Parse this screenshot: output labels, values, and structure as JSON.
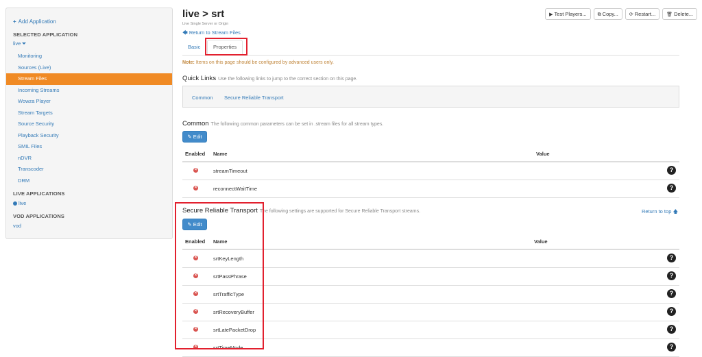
{
  "sidebar": {
    "add_application": "Add Application",
    "selected_heading": "SELECTED APPLICATION",
    "selected_app": "live",
    "menu": [
      {
        "label": "Monitoring",
        "active": false
      },
      {
        "label": "Sources (Live)",
        "active": false
      },
      {
        "label": "Stream Files",
        "active": true
      },
      {
        "label": "Incoming Streams",
        "active": false
      },
      {
        "label": "Wowza Player",
        "active": false
      },
      {
        "label": "Stream Targets",
        "active": false
      },
      {
        "label": "Source Security",
        "active": false
      },
      {
        "label": "Playback Security",
        "active": false
      },
      {
        "label": "SMIL Files",
        "active": false
      },
      {
        "label": "nDVR",
        "active": false
      },
      {
        "label": "Transcoder",
        "active": false
      },
      {
        "label": "DRM",
        "active": false
      }
    ],
    "live_heading": "LIVE APPLICATIONS",
    "live_app": "live",
    "vod_heading": "VOD APPLICATIONS",
    "vod_app": "vod"
  },
  "header": {
    "title": "live > srt",
    "subtitle": "Live Single Server or Origin",
    "return_link": "Return to Stream Files",
    "buttons": {
      "test_players": "Test Players...",
      "copy": "Copy...",
      "restart": "Restart...",
      "delete": "Delete..."
    }
  },
  "tabs": {
    "basic": "Basic",
    "properties": "Properties"
  },
  "note": {
    "label": "Note:",
    "text": "Items on this page should be configured by advanced users only."
  },
  "quick_links": {
    "title": "Quick Links",
    "desc": "Use the following links to jump to the correct section on this page.",
    "links": [
      "Common",
      "Secure Reliable Transport"
    ]
  },
  "common": {
    "title": "Common",
    "desc": "The following common parameters can be set in .stream files for all stream types.",
    "edit": "Edit",
    "columns": {
      "enabled": "Enabled",
      "name": "Name",
      "value": "Value"
    },
    "rows": [
      "streamTimeout",
      "reconnectWaitTime"
    ]
  },
  "srt": {
    "title": "Secure Reliable Transport",
    "desc": "The following settings are supported for Secure Reliable Transport streams.",
    "return_top": "Return to top",
    "edit": "Edit",
    "columns": {
      "enabled": "Enabled",
      "name": "Name",
      "value": "Value"
    },
    "rows": [
      "srtKeyLength",
      "srtPassPhrase",
      "srtTrafficType",
      "srtRecoveryBuffer",
      "srtLatePacketDrop",
      "srtTimeMode"
    ]
  },
  "colors": {
    "accent": "#337ab7",
    "active_menu": "#f08a24",
    "highlight": "#e2202e",
    "edit_button": "#428bca",
    "disabled_icon": "#d9534f"
  }
}
